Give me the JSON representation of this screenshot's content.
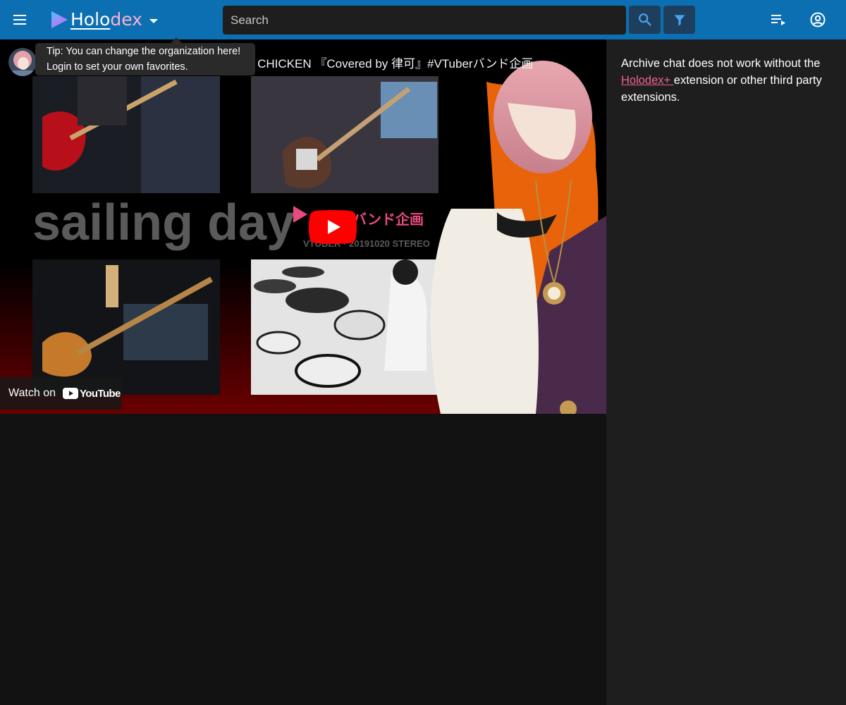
{
  "app": {
    "logo_holo": "Holo",
    "logo_dex": "dex",
    "brand_color": "#0c6fb2",
    "accent_color": "#f06292"
  },
  "header": {
    "search_placeholder": "Search",
    "menu_icon": "hamburger-menu-icon",
    "search_icon": "magnify-icon",
    "filter_icon": "funnel-filter-icon",
    "queue_icon": "playlist-play-icon",
    "account_icon": "account-circle-icon"
  },
  "tooltip": {
    "line1": "Tip: You can change the organization here!",
    "line2": "Login to set your own favorites."
  },
  "player": {
    "title": "F CHICKEN 『Covered by 律可』#VTuberバンド企画",
    "watch_on": "Watch on",
    "youtube": "YouTube",
    "thumbnail_text": "sailing day",
    "thumbnail_sub": "バンド企画",
    "thumbnail_caption": "VTUBER · 20191020 STEREO"
  },
  "chat": {
    "msg_before": "Archive chat does not work without the ",
    "link_text": "Holodex+ ",
    "msg_after": "extension or other third party extensions."
  }
}
